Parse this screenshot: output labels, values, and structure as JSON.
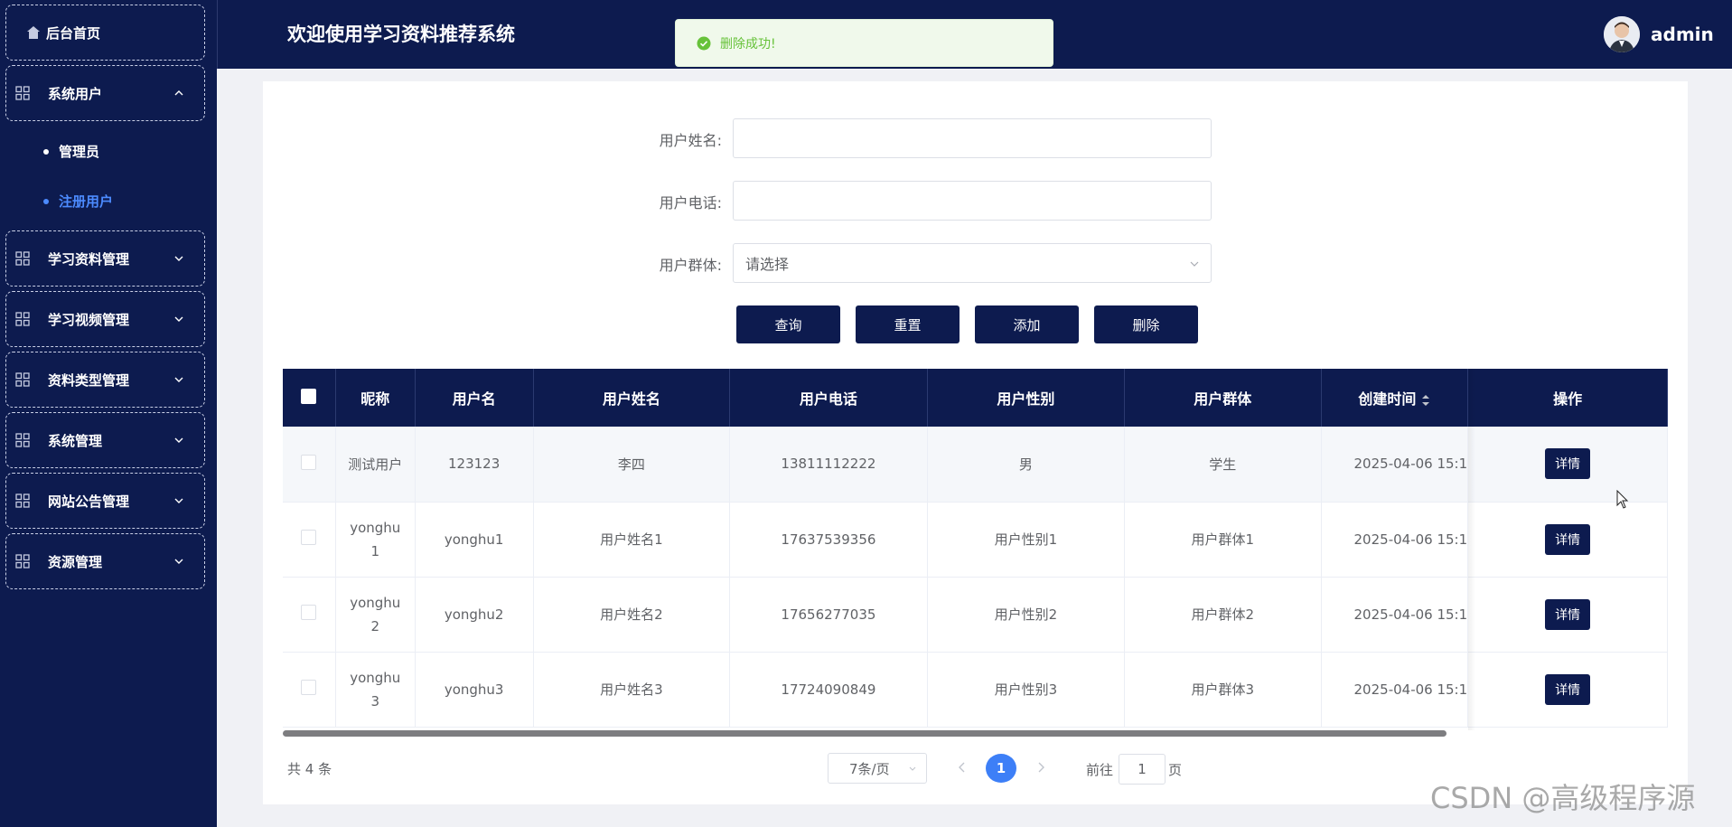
{
  "app": {
    "title": "欢迎使用学习资料推荐系统",
    "user": "admin"
  },
  "toast": {
    "message": "删除成功!",
    "color": "#67c23a"
  },
  "sidebar": {
    "home": "后台首页",
    "groups": [
      {
        "label": "系统用户",
        "expanded": true,
        "children": [
          {
            "label": "管理员",
            "active": false
          },
          {
            "label": "注册用户",
            "active": true
          }
        ]
      },
      {
        "label": "学习资料管理",
        "expanded": false
      },
      {
        "label": "学习视频管理",
        "expanded": false
      },
      {
        "label": "资料类型管理",
        "expanded": false
      },
      {
        "label": "系统管理",
        "expanded": false
      },
      {
        "label": "网站公告管理",
        "expanded": false
      },
      {
        "label": "资源管理",
        "expanded": false
      }
    ]
  },
  "form": {
    "name_label": "用户姓名:",
    "name_value": "",
    "phone_label": "用户电话:",
    "phone_value": "",
    "group_label": "用户群体:",
    "group_placeholder": "请选择",
    "buttons": {
      "query": "查询",
      "reset": "重置",
      "add": "添加",
      "delete": "删除"
    }
  },
  "table": {
    "headers": [
      "昵称",
      "用户名",
      "用户姓名",
      "用户电话",
      "用户性别",
      "用户群体",
      "创建时间",
      "操作"
    ],
    "rows": [
      {
        "nickname": "测试用户",
        "username": "123123",
        "name": "李四",
        "phone": "13811112222",
        "gender": "男",
        "group": "学生",
        "created": "2025-04-06 15:1",
        "action": "详情"
      },
      {
        "nickname": "yonghu\n1",
        "username": "yonghu1",
        "name": "用户姓名1",
        "phone": "17637539356",
        "gender": "用户性别1",
        "group": "用户群体1",
        "created": "2025-04-06 15:1",
        "action": "详情"
      },
      {
        "nickname": "yonghu\n2",
        "username": "yonghu2",
        "name": "用户姓名2",
        "phone": "17656277035",
        "gender": "用户性别2",
        "group": "用户群体2",
        "created": "2025-04-06 15:1",
        "action": "详情"
      },
      {
        "nickname": "yonghu\n3",
        "username": "yonghu3",
        "name": "用户姓名3",
        "phone": "17724090849",
        "gender": "用户性别3",
        "group": "用户群体3",
        "created": "2025-04-06 15:1",
        "action": "详情"
      }
    ]
  },
  "pagination": {
    "total": "共 4 条",
    "page_size": "7条/页",
    "current": "1",
    "goto_prefix": "前往",
    "goto_value": "1",
    "goto_suffix": "页"
  },
  "watermark": "CSDN @高级程序源",
  "colors": {
    "navy": "#0d1b4f",
    "accent": "#3d7ff7",
    "active_menu": "#4c8bff"
  }
}
